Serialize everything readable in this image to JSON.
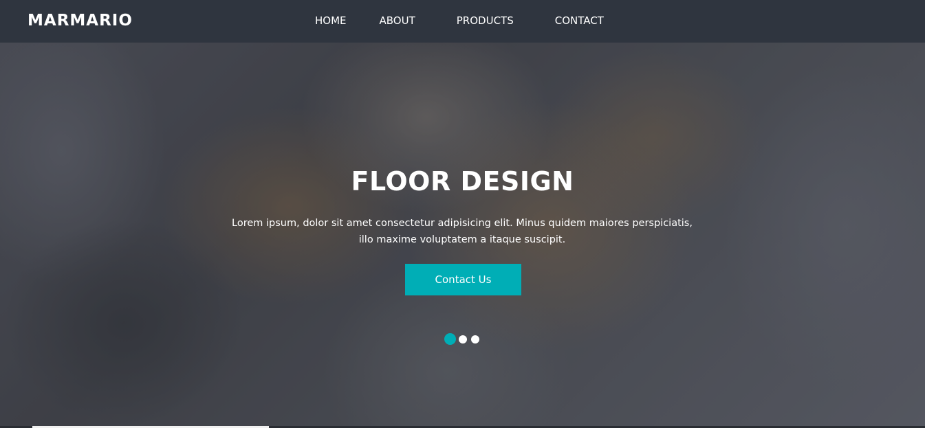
{
  "navbar": {
    "brand": "MARMARIO",
    "links": [
      {
        "label": "HOME"
      },
      {
        "label": "ABOUT"
      },
      {
        "label": "PRODUCTS"
      },
      {
        "label": "CONTACT"
      }
    ]
  },
  "hero": {
    "title": "FLOOR DESIGN",
    "text_line1": "Lorem ipsum, dolor sit amet consectetur adipisicing elit. Minus quidem maiores perspiciatis,",
    "text_line2": "illo maxime voluptatem a itaque suscipit.",
    "cta_label": "Contact Us"
  },
  "carousel": {
    "slide_count": 3,
    "active_index": 0
  },
  "colors": {
    "navbar_bg": "#2f353f",
    "accent": "#00aeb6",
    "text": "#ffffff"
  }
}
